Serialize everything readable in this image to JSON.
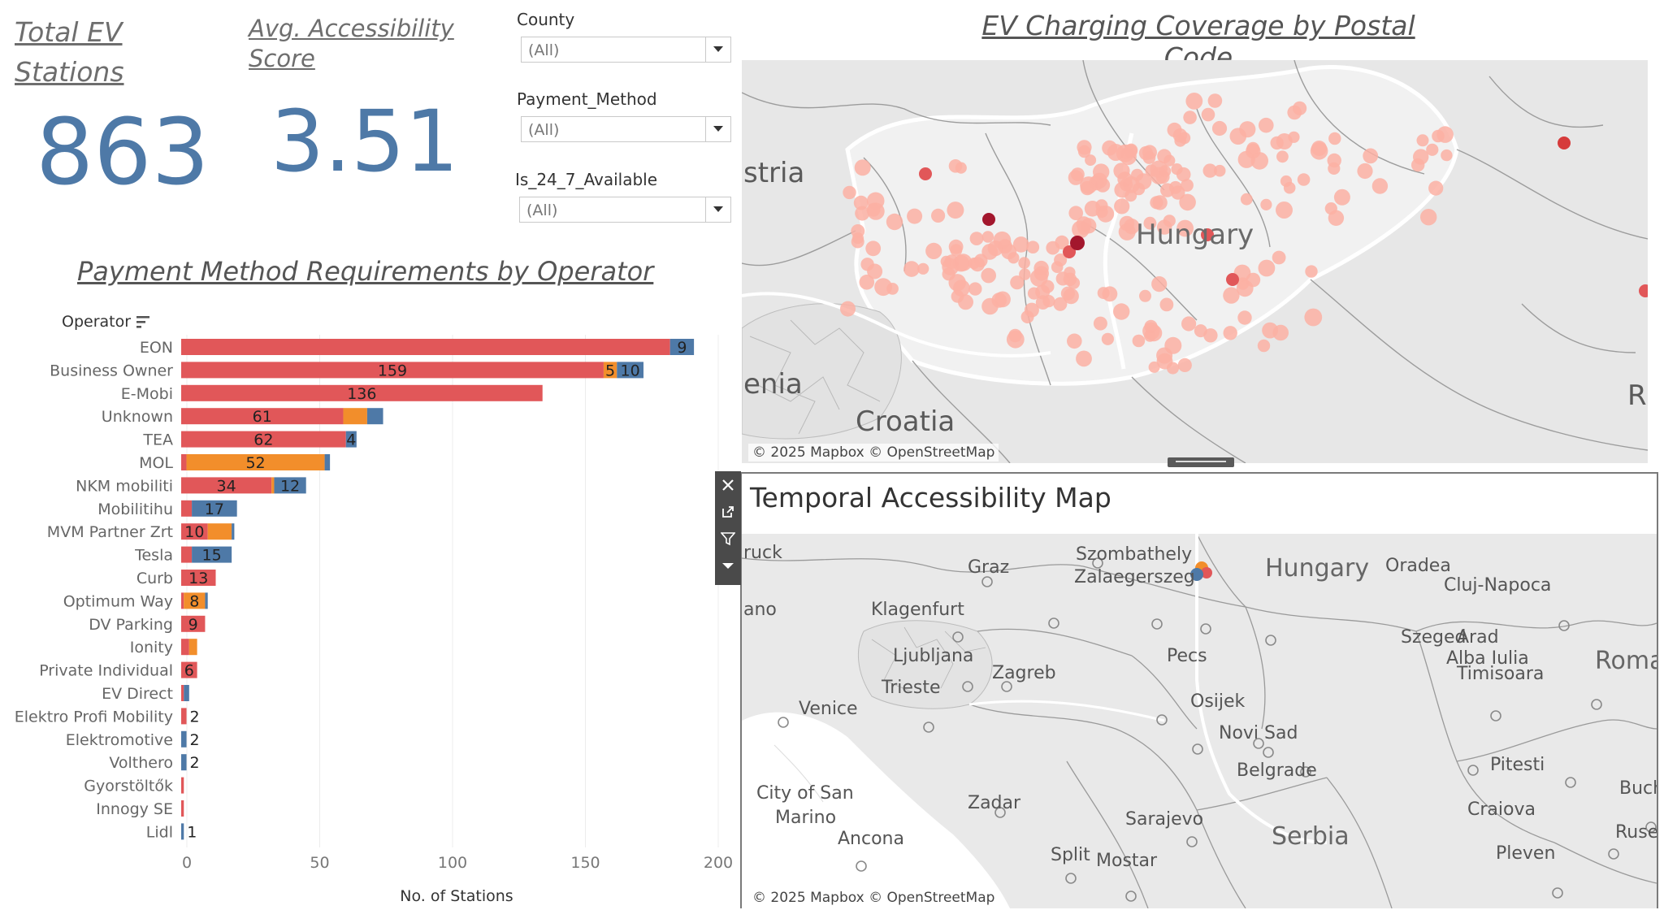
{
  "kpis": {
    "total_stations": {
      "title": "Total EV Stations",
      "value": "863"
    },
    "accessibility": {
      "title": "Avg. Accessibility Score",
      "value": "3.51"
    }
  },
  "filters": [
    {
      "label": "County",
      "value": "(All)"
    },
    {
      "label": "Payment_Method",
      "value": "(All)"
    },
    {
      "label": "Is_24_7_Available",
      "value": "(All)"
    }
  ],
  "map_top": {
    "title": "EV Charging Coverage by Postal Code",
    "attribution": "© 2025 Mapbox © OpenStreetMap",
    "labels": [
      "stria",
      "Hungary",
      "enia",
      "Croatia",
      "R"
    ]
  },
  "map_bottom": {
    "title": "Temporal Accessibility Map",
    "attribution": "© 2025 Mapbox © OpenStreetMap",
    "labels": [
      "ruck",
      "Graz",
      "Szombathely",
      "Zalaegerszeg",
      "Hungary",
      "Oradea",
      "Cluj-Napoca",
      "ano",
      "Klagenfurt",
      "Szeged",
      "Arad",
      "Alba Iulia",
      "Romania",
      "Ljubljana",
      "Pecs",
      "Timisoara",
      "Trieste",
      "Zagreb",
      "Venice",
      "Osijek",
      "Novi Sad",
      "Belgrade",
      "Pitesti",
      "Buchar",
      "City of San",
      "Marino",
      "Zadar",
      "Craiova",
      "Sarajevo",
      "Serbia",
      "Ruse",
      "Ancona",
      "Split",
      "Mostar",
      "Pleven"
    ]
  },
  "chart_data": {
    "type": "bar",
    "title": "Payment Method Requirements by Operator",
    "ylabel": "Operator",
    "xlabel": "No. of Stations",
    "xlim": [
      0,
      200
    ],
    "xticks": [
      "0",
      "50",
      "100",
      "150",
      "200"
    ],
    "series_colors": [
      "#e15759",
      "#f28e2b",
      "#4e79a7"
    ],
    "rows": [
      {
        "name": "EON",
        "values": [
          184,
          0,
          9
        ],
        "labels": [
          "",
          "",
          "9"
        ]
      },
      {
        "name": "Business Owner",
        "values": [
          159,
          5,
          10
        ],
        "labels": [
          "159",
          "5",
          "10"
        ]
      },
      {
        "name": "E-Mobi",
        "values": [
          136,
          0,
          0
        ],
        "labels": [
          "136",
          "",
          ""
        ]
      },
      {
        "name": "Unknown",
        "values": [
          61,
          9,
          6
        ],
        "labels": [
          "61",
          "",
          ""
        ]
      },
      {
        "name": "TEA",
        "values": [
          62,
          0,
          4
        ],
        "labels": [
          "62",
          "",
          "4"
        ]
      },
      {
        "name": "MOL",
        "values": [
          2,
          52,
          2
        ],
        "labels": [
          "",
          "52",
          ""
        ]
      },
      {
        "name": "NKM mobiliti",
        "values": [
          34,
          1,
          12
        ],
        "labels": [
          "34",
          "",
          "12"
        ]
      },
      {
        "name": "Mobilitihu",
        "values": [
          4,
          0,
          17
        ],
        "labels": [
          "",
          "",
          "17"
        ]
      },
      {
        "name": "MVM Partner Zrt",
        "values": [
          10,
          9,
          1
        ],
        "labels": [
          "10",
          "",
          ""
        ]
      },
      {
        "name": "Tesla",
        "values": [
          4,
          0,
          15
        ],
        "labels": [
          "",
          "",
          "15"
        ]
      },
      {
        "name": "Curb",
        "values": [
          13,
          0,
          0
        ],
        "labels": [
          "13",
          "",
          ""
        ]
      },
      {
        "name": "Optimum Way",
        "values": [
          1,
          8,
          1
        ],
        "labels": [
          "",
          "8",
          ""
        ]
      },
      {
        "name": "DV Parking",
        "values": [
          9,
          0,
          0
        ],
        "labels": [
          "9",
          "",
          ""
        ]
      },
      {
        "name": "Ionity",
        "values": [
          3,
          3,
          0
        ],
        "labels": [
          "",
          "",
          ""
        ]
      },
      {
        "name": "Private Individual",
        "values": [
          6,
          0,
          0
        ],
        "labels": [
          "6",
          "",
          ""
        ]
      },
      {
        "name": "EV Direct",
        "values": [
          1,
          0,
          2
        ],
        "labels": [
          "",
          "",
          ""
        ]
      },
      {
        "name": "Elektro Profi Mobility",
        "values": [
          2,
          0,
          0
        ],
        "labels": [
          "2",
          "",
          ""
        ]
      },
      {
        "name": "Elektromotive",
        "values": [
          0,
          0,
          2
        ],
        "labels": [
          "",
          "",
          "2"
        ]
      },
      {
        "name": "Volthero",
        "values": [
          0,
          0,
          2
        ],
        "labels": [
          "",
          "",
          "2"
        ]
      },
      {
        "name": "Gyorstöltők",
        "values": [
          1,
          0,
          0
        ],
        "labels": [
          "",
          "",
          ""
        ]
      },
      {
        "name": "Innogy SE",
        "values": [
          1,
          0,
          0
        ],
        "labels": [
          "",
          "",
          ""
        ]
      },
      {
        "name": "Lidl",
        "values": [
          0,
          0,
          1
        ],
        "labels": [
          "",
          "",
          "1"
        ]
      }
    ]
  }
}
